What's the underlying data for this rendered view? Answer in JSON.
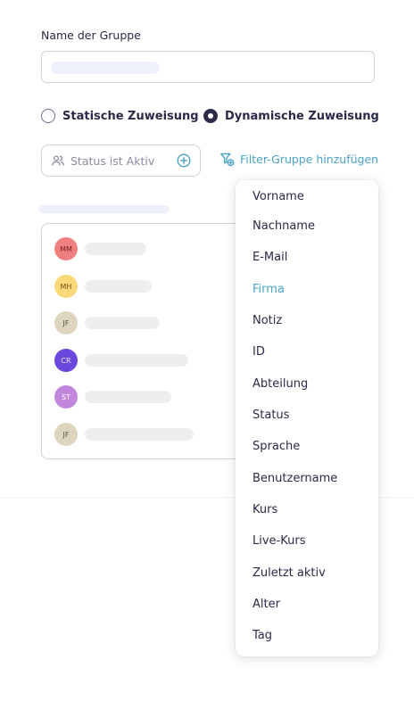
{
  "form": {
    "group_name_label": "Name der Gruppe"
  },
  "assignment": {
    "static_label": "Statische Zuweisung",
    "dynamic_label": "Dynamische Zuweisung",
    "selected": "dynamic"
  },
  "filter": {
    "pill_text": "Status ist Aktiv",
    "add_group_label": "Filter-Gruppe hinzufügen"
  },
  "members": [
    {
      "initials": "MM",
      "bg": "#f07f7f",
      "fg": "#7a2222"
    },
    {
      "initials": "MH",
      "bg": "#fbd978",
      "fg": "#6e5412"
    },
    {
      "initials": "JF",
      "bg": "#ddd5bd",
      "fg": "#5b5238"
    },
    {
      "initials": "CR",
      "bg": "#6b49de",
      "fg": "#e8e2ff"
    },
    {
      "initials": "ST",
      "bg": "#c286dc",
      "fg": "#ffffff"
    },
    {
      "initials": "JF",
      "bg": "#ddd5bd",
      "fg": "#5b5238"
    }
  ],
  "dropdown": {
    "items": [
      {
        "label": "Vorname"
      },
      {
        "label": "Nachname"
      },
      {
        "label": "E-Mail"
      },
      {
        "label": "Firma",
        "active": true
      },
      {
        "label": "Notiz"
      },
      {
        "label": "ID"
      },
      {
        "label": "Abteilung"
      },
      {
        "label": "Status"
      },
      {
        "label": "Sprache"
      },
      {
        "label": "Benutzername"
      },
      {
        "label": "Kurs"
      },
      {
        "label": "Live-Kurs"
      },
      {
        "label": "Zuletzt aktiv"
      },
      {
        "label": "Alter"
      },
      {
        "label": "Tag"
      }
    ]
  },
  "colors": {
    "accent": "#4aa3c4",
    "text": "#2a2a48",
    "border": "#cfd2dc"
  }
}
